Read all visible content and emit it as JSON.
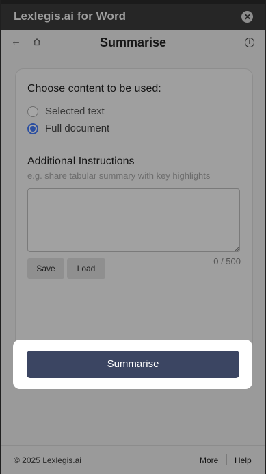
{
  "window": {
    "title": "Lexlegis.ai for Word"
  },
  "header": {
    "title": "Summarise",
    "back_icon": "arrow-left-icon",
    "home_icon": "home-icon",
    "info_icon": "info-icon"
  },
  "content": {
    "choose_label": "Choose content to be used:",
    "options": [
      {
        "label": "Selected text",
        "selected": false
      },
      {
        "label": "Full document",
        "selected": true
      }
    ],
    "instructions_label": "Additional Instructions",
    "instructions_placeholder": "e.g. share tabular summary with key highlights",
    "instructions_value": "",
    "char_count": "0 / 500",
    "save_label": "Save",
    "load_label": "Load"
  },
  "action": {
    "summarise_label": "Summarise",
    "accent_color": "#3b4562"
  },
  "footer": {
    "copyright": "© 2025 Lexlegis.ai",
    "more_label": "More",
    "help_label": "Help"
  }
}
